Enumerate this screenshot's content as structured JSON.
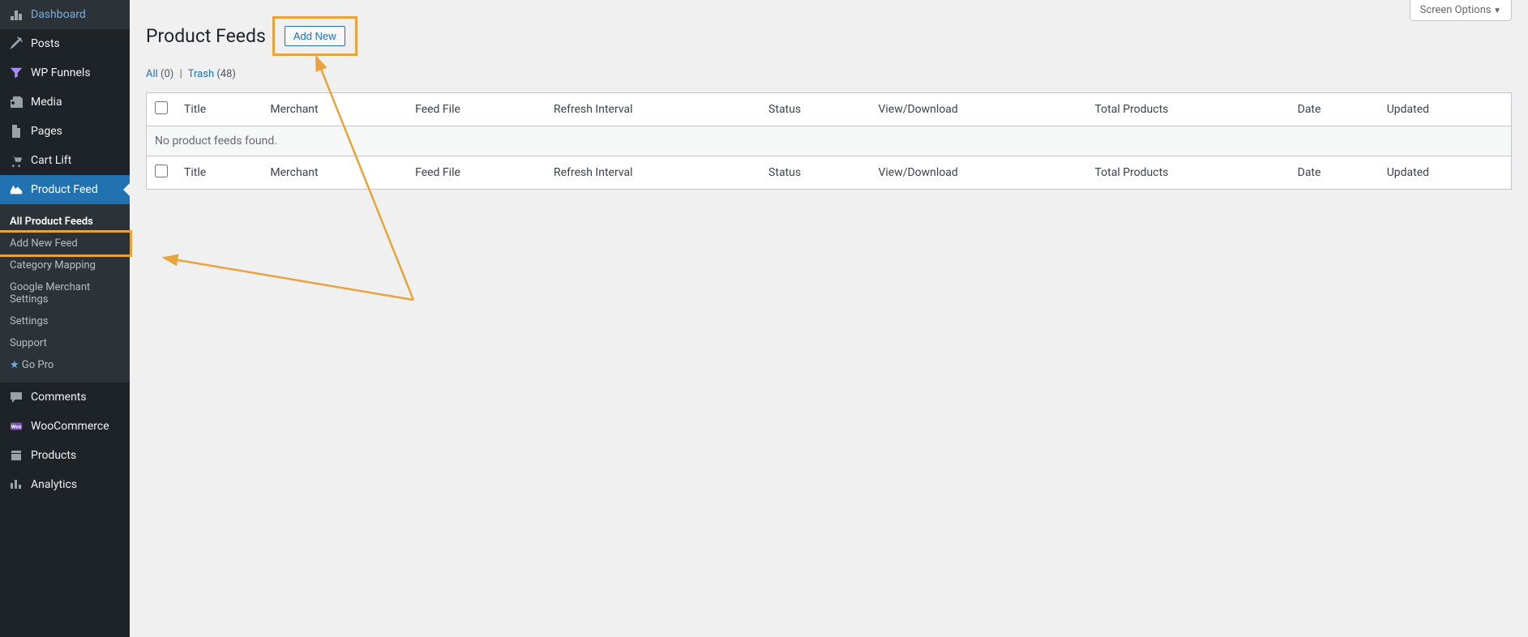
{
  "sidebar": {
    "items": [
      {
        "icon": "dashboard",
        "label": "Dashboard"
      },
      {
        "icon": "posts",
        "label": "Posts"
      },
      {
        "icon": "funnels",
        "label": "WP Funnels"
      },
      {
        "icon": "media",
        "label": "Media"
      },
      {
        "icon": "pages",
        "label": "Pages"
      },
      {
        "icon": "cartlift",
        "label": "Cart Lift"
      },
      {
        "icon": "product-feed",
        "label": "Product Feed",
        "active": true
      },
      {
        "icon": "comments",
        "label": "Comments"
      },
      {
        "icon": "woocommerce",
        "label": "WooCommerce"
      },
      {
        "icon": "products",
        "label": "Products"
      },
      {
        "icon": "analytics",
        "label": "Analytics"
      }
    ],
    "submenu": {
      "items": [
        {
          "label": "All Product Feeds",
          "current": true
        },
        {
          "label": "Add New Feed",
          "highlighted": true
        },
        {
          "label": "Category Mapping"
        },
        {
          "label": "Google Merchant Settings"
        },
        {
          "label": "Settings"
        },
        {
          "label": "Support"
        },
        {
          "label": "Go Pro",
          "star": true
        }
      ]
    }
  },
  "main": {
    "screen_options": "Screen Options",
    "page_title": "Product Feeds",
    "add_new_label": "Add New",
    "filters": {
      "all_label": "All",
      "all_count": "(0)",
      "trash_label": "Trash",
      "trash_count": "(48)"
    },
    "table": {
      "columns": [
        "Title",
        "Merchant",
        "Feed File",
        "Refresh Interval",
        "Status",
        "View/Download",
        "Total Products",
        "Date",
        "Updated"
      ],
      "sortable_cols": [
        "Title",
        "Date"
      ],
      "empty_message": "No product feeds found."
    }
  }
}
